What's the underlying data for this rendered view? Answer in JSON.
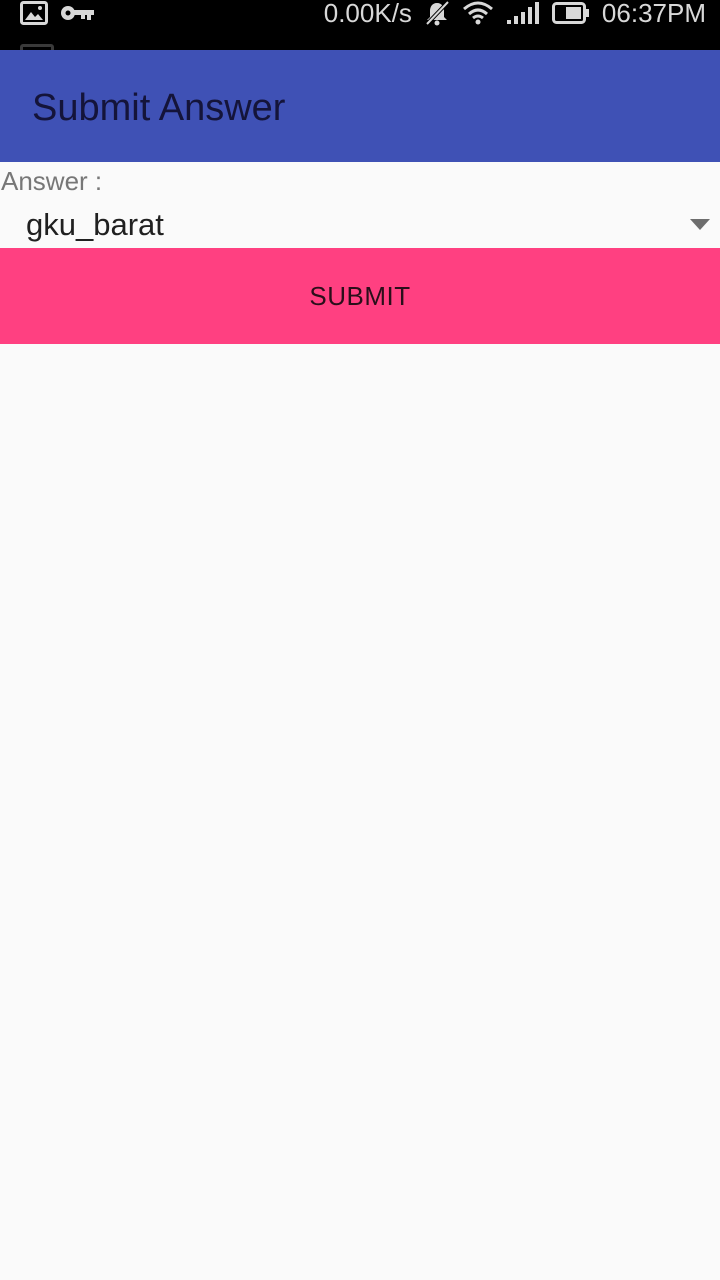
{
  "status_bar": {
    "speed": "0.00K/s",
    "time": "06:37PM",
    "icons": [
      "image-icon",
      "key-icon",
      "mute-icon",
      "wifi-icon",
      "signal-icon",
      "battery-icon"
    ]
  },
  "app_bar": {
    "title": "Submit Answer",
    "color": "#3f51b5"
  },
  "form": {
    "answer_label": "Answer :",
    "answer_value": "gku_barat"
  },
  "submit": {
    "label": "SUBMIT",
    "color": "#ff4081"
  }
}
